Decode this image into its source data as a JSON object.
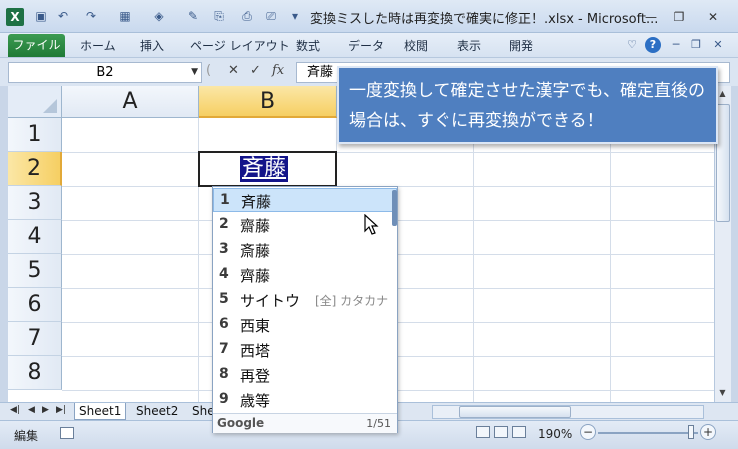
{
  "window": {
    "title": "変換ミスした時は再変換で確実に修正！.xlsx - Microsoft...",
    "app_logo": "X"
  },
  "ribbon": {
    "tabs": [
      "ファイル",
      "ホーム",
      "挿入",
      "ページ レイアウト",
      "数式",
      "データ",
      "校閲",
      "表示",
      "開発"
    ]
  },
  "formula_bar": {
    "name_box": "B2",
    "fx_label": "fx",
    "content": "斉藤"
  },
  "sheet": {
    "columns": [
      "A",
      "B"
    ],
    "rows": [
      "1",
      "2",
      "3",
      "4",
      "5",
      "6",
      "7",
      "8"
    ],
    "selected_column": "B",
    "selected_row": "2",
    "active_cell_text": "斉藤"
  },
  "ime_candidates": {
    "items": [
      {
        "num": "1",
        "word": "斉藤",
        "note": ""
      },
      {
        "num": "2",
        "word": "齋藤",
        "note": ""
      },
      {
        "num": "3",
        "word": "斎藤",
        "note": ""
      },
      {
        "num": "4",
        "word": "齊藤",
        "note": ""
      },
      {
        "num": "5",
        "word": "サイトウ",
        "note": "[全] カタカナ"
      },
      {
        "num": "6",
        "word": "西東",
        "note": ""
      },
      {
        "num": "7",
        "word": "西塔",
        "note": ""
      },
      {
        "num": "8",
        "word": "再登",
        "note": ""
      },
      {
        "num": "9",
        "word": "歳等",
        "note": ""
      }
    ],
    "brand": "Google",
    "count": "1/51"
  },
  "callout": {
    "text": "一度変換して確定させた漢字でも、確定直後の場合は、すぐに再変換ができる！"
  },
  "sheet_tabs": [
    "Sheet1",
    "Sheet2",
    "She"
  ],
  "status_bar": {
    "mode": "編集",
    "zoom": "190%"
  },
  "colors": {
    "file_tab": "#1f7a36",
    "selected_header": "#f6cf63",
    "callout_bg": "#4f7fc0",
    "ime_selection": "#cce4fa",
    "highlight_text_bg": "#13148a"
  }
}
